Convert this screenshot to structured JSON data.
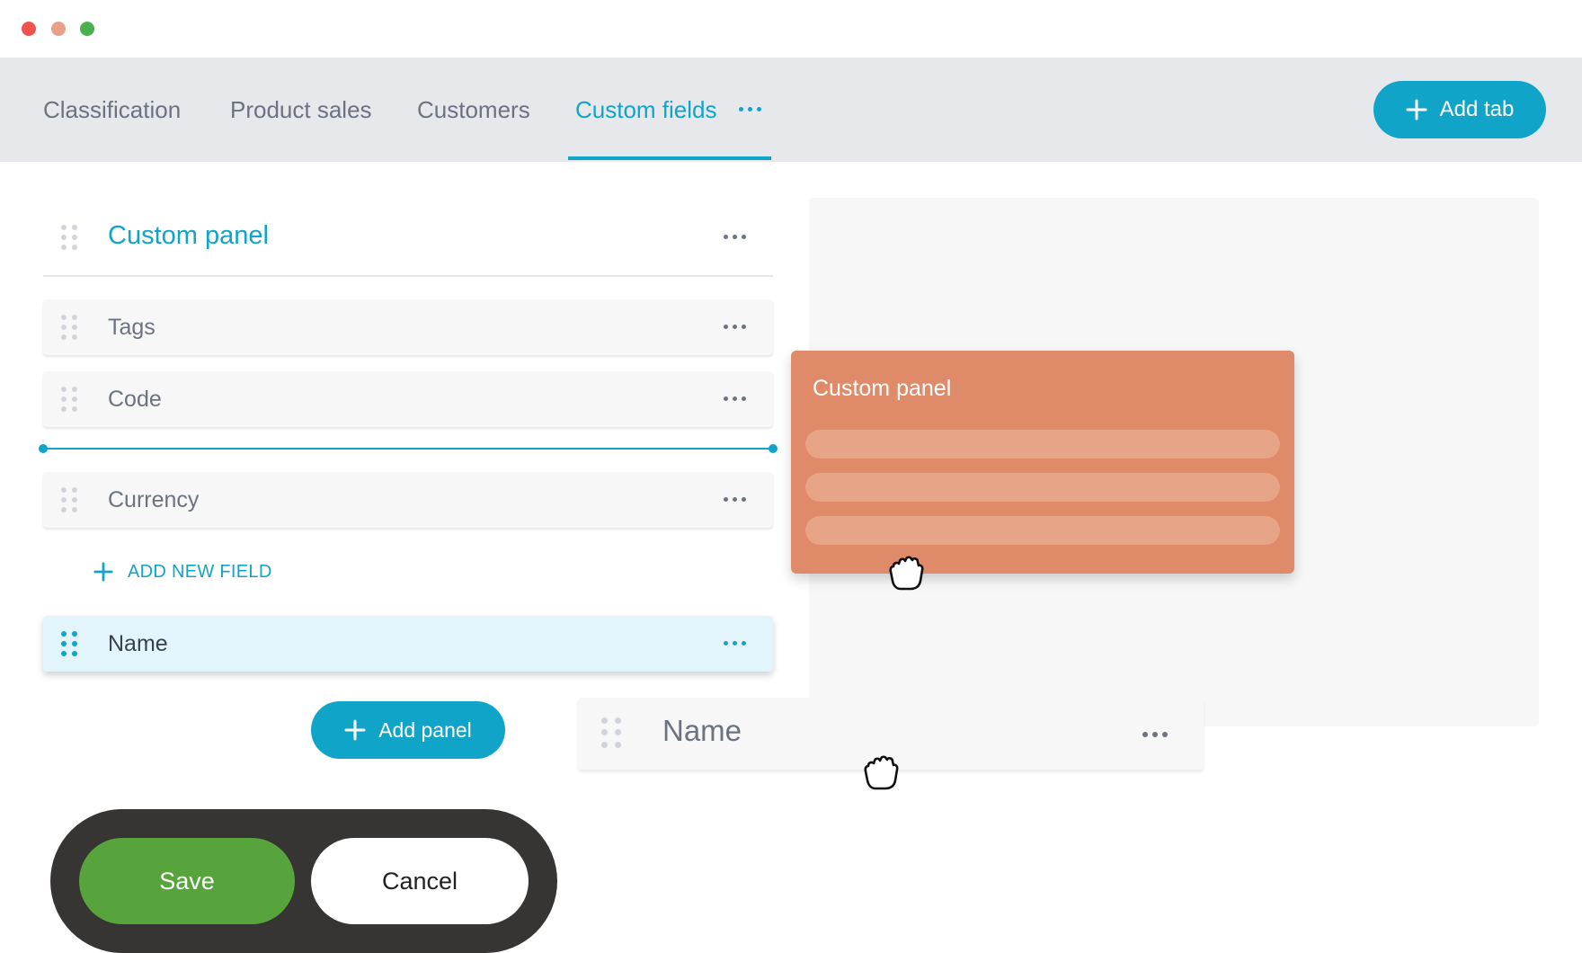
{
  "window": {
    "controls": [
      "close",
      "minimize",
      "maximize"
    ]
  },
  "tabs": {
    "items": [
      {
        "label": "Classification",
        "active": false
      },
      {
        "label": "Product sales",
        "active": false
      },
      {
        "label": "Customers",
        "active": false
      },
      {
        "label": "Custom fields",
        "active": true
      }
    ],
    "more_icon": "more-horizontal-icon",
    "add_tab_label": "Add tab"
  },
  "panel": {
    "title": "Custom panel",
    "fields": [
      {
        "label": "Tags"
      },
      {
        "label": "Code"
      },
      {
        "label": "Currency"
      }
    ],
    "add_field_label": "ADD NEW FIELD",
    "selected_field": {
      "label": "Name"
    },
    "add_panel_label": "Add panel"
  },
  "dragging": {
    "panel_title": "Custom panel",
    "field_label": "Name"
  },
  "actions": {
    "save_label": "Save",
    "cancel_label": "Cancel"
  },
  "colors": {
    "accent": "#11a4c9",
    "drag_panel": "#df8a68",
    "save": "#58a43c",
    "pill": "#373434"
  }
}
